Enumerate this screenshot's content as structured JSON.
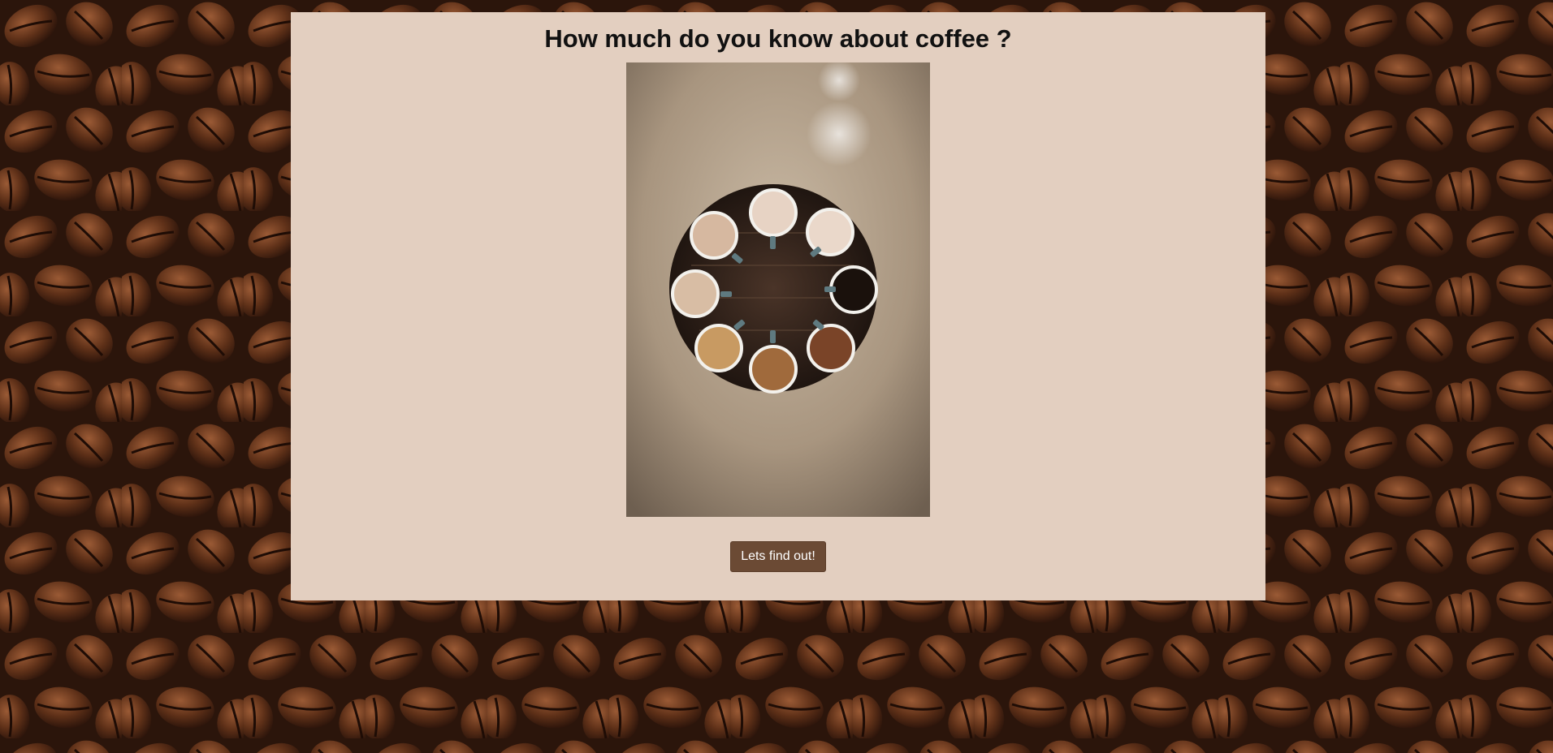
{
  "page": {
    "title": "How much do you know about coffee ?",
    "start_button_label": "Lets find out!"
  },
  "colors": {
    "card_background": "#e3cfc0",
    "button_background": "#6b4a34",
    "button_text": "#ffffff",
    "background_theme": "#3a2014"
  },
  "images": {
    "background": "coffee-beans-background",
    "hero": "coffee-cups-on-round-tray"
  }
}
